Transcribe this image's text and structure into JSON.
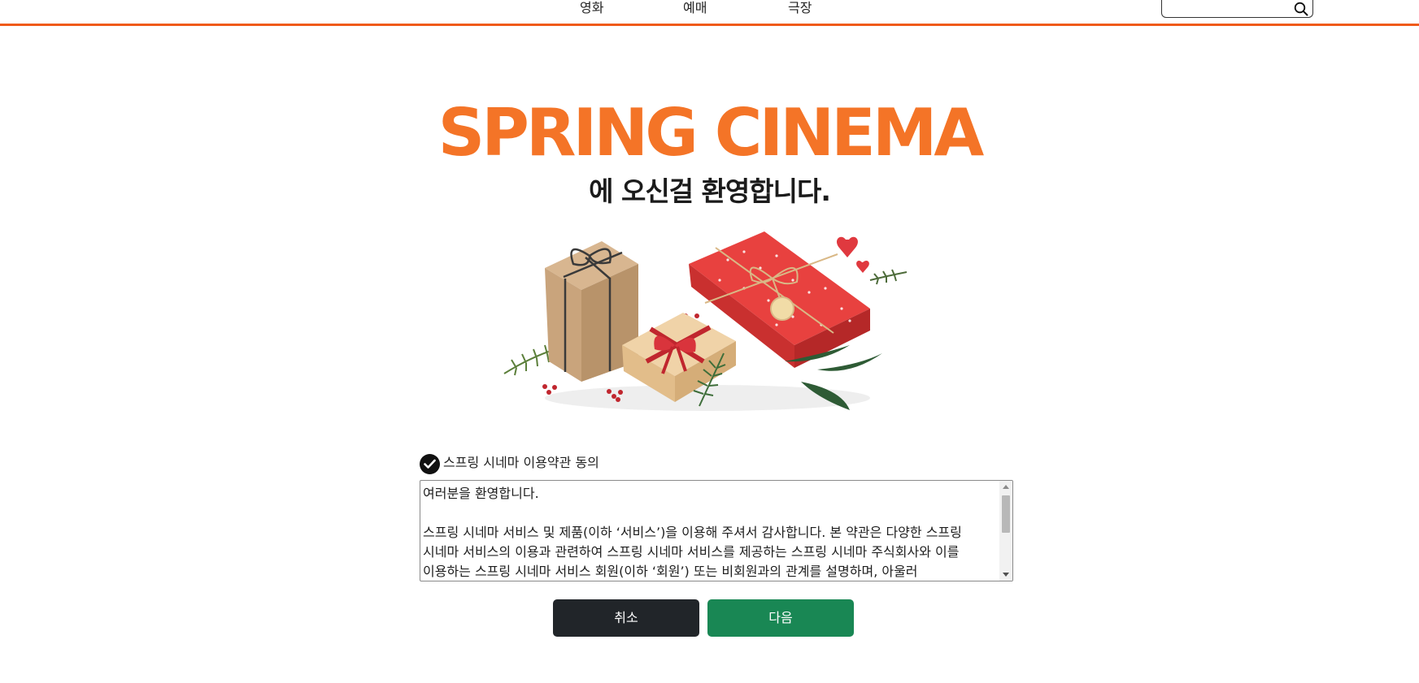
{
  "header": {
    "nav": [
      {
        "label": "영화"
      },
      {
        "label": "예매"
      },
      {
        "label": "극장"
      }
    ],
    "search": {
      "value": "",
      "placeholder": "",
      "icon": "search-icon"
    },
    "accent_color": "#f05a1a"
  },
  "hero": {
    "title": "SPRING CINEMA",
    "subtitle": "에 오신걸 환영합니다.",
    "title_color": "#f47427",
    "illustration": "gift-boxes-illustration"
  },
  "terms": {
    "label": "스프링 시네마 이용약관 동의",
    "checked": true,
    "text": "여러분을 환영합니다.\n\n스프링 시네마 서비스 및 제품(이하 ‘서비스’)을 이용해 주셔서 감사합니다. 본 약관은 다양한 스프링 시네마 서비스의 이용과 관련하여 스프링 시네마 서비스를 제공하는 스프링 시네마 주식회사와 이를 이용하는 스프링 시네마 서비스 회원(이하 ‘회원’) 또는 비회원과의 관계를 설명하며, 아울러"
  },
  "buttons": {
    "cancel_label": "취소",
    "next_label": "다음",
    "cancel_color": "#212529",
    "next_color": "#198754"
  }
}
